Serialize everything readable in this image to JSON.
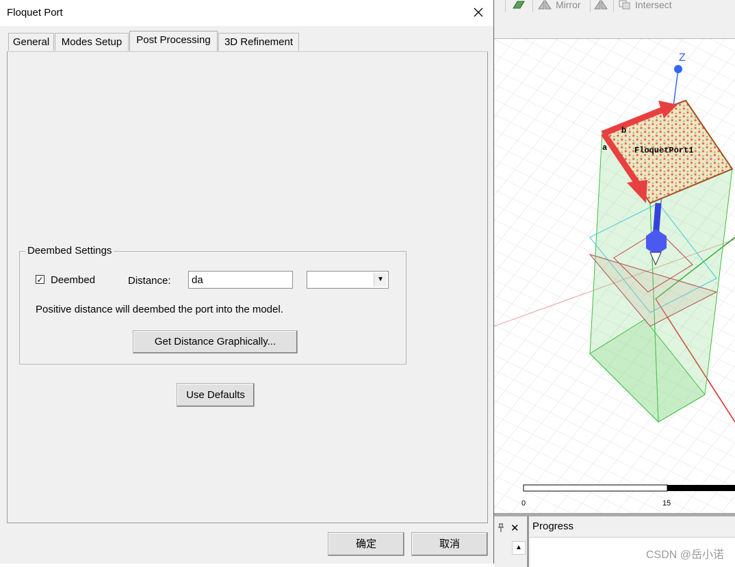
{
  "dialog": {
    "title": "Floquet Port",
    "tabs": [
      {
        "label": "General"
      },
      {
        "label": "Modes Setup"
      },
      {
        "label": "Post Processing"
      },
      {
        "label": "3D Refinement"
      }
    ],
    "active_tab": "Post Processing",
    "deembed": {
      "group_label": "Deembed Settings",
      "checkbox_label": "Deembed",
      "checked": true,
      "distance_label": "Distance:",
      "distance_value": "da",
      "units_value": "",
      "hint": "Positive distance will deembed the port into the model.",
      "graphical_button": "Get Distance Graphically..."
    },
    "use_defaults_button": "Use Defaults",
    "ok_button": "确定",
    "cancel_button": "取消"
  },
  "app": {
    "toolbar": {
      "mirror_label": "Mirror",
      "intersect_label": "Intersect"
    },
    "viewport": {
      "axis_z_label": "Z",
      "port_label": "FloquetPort1",
      "vector_a_label": "a",
      "vector_b_label": "b",
      "scale_start": "0",
      "scale_mid": "15"
    },
    "progress_label": "Progress",
    "watermark": "CSDN @岳小诺"
  }
}
